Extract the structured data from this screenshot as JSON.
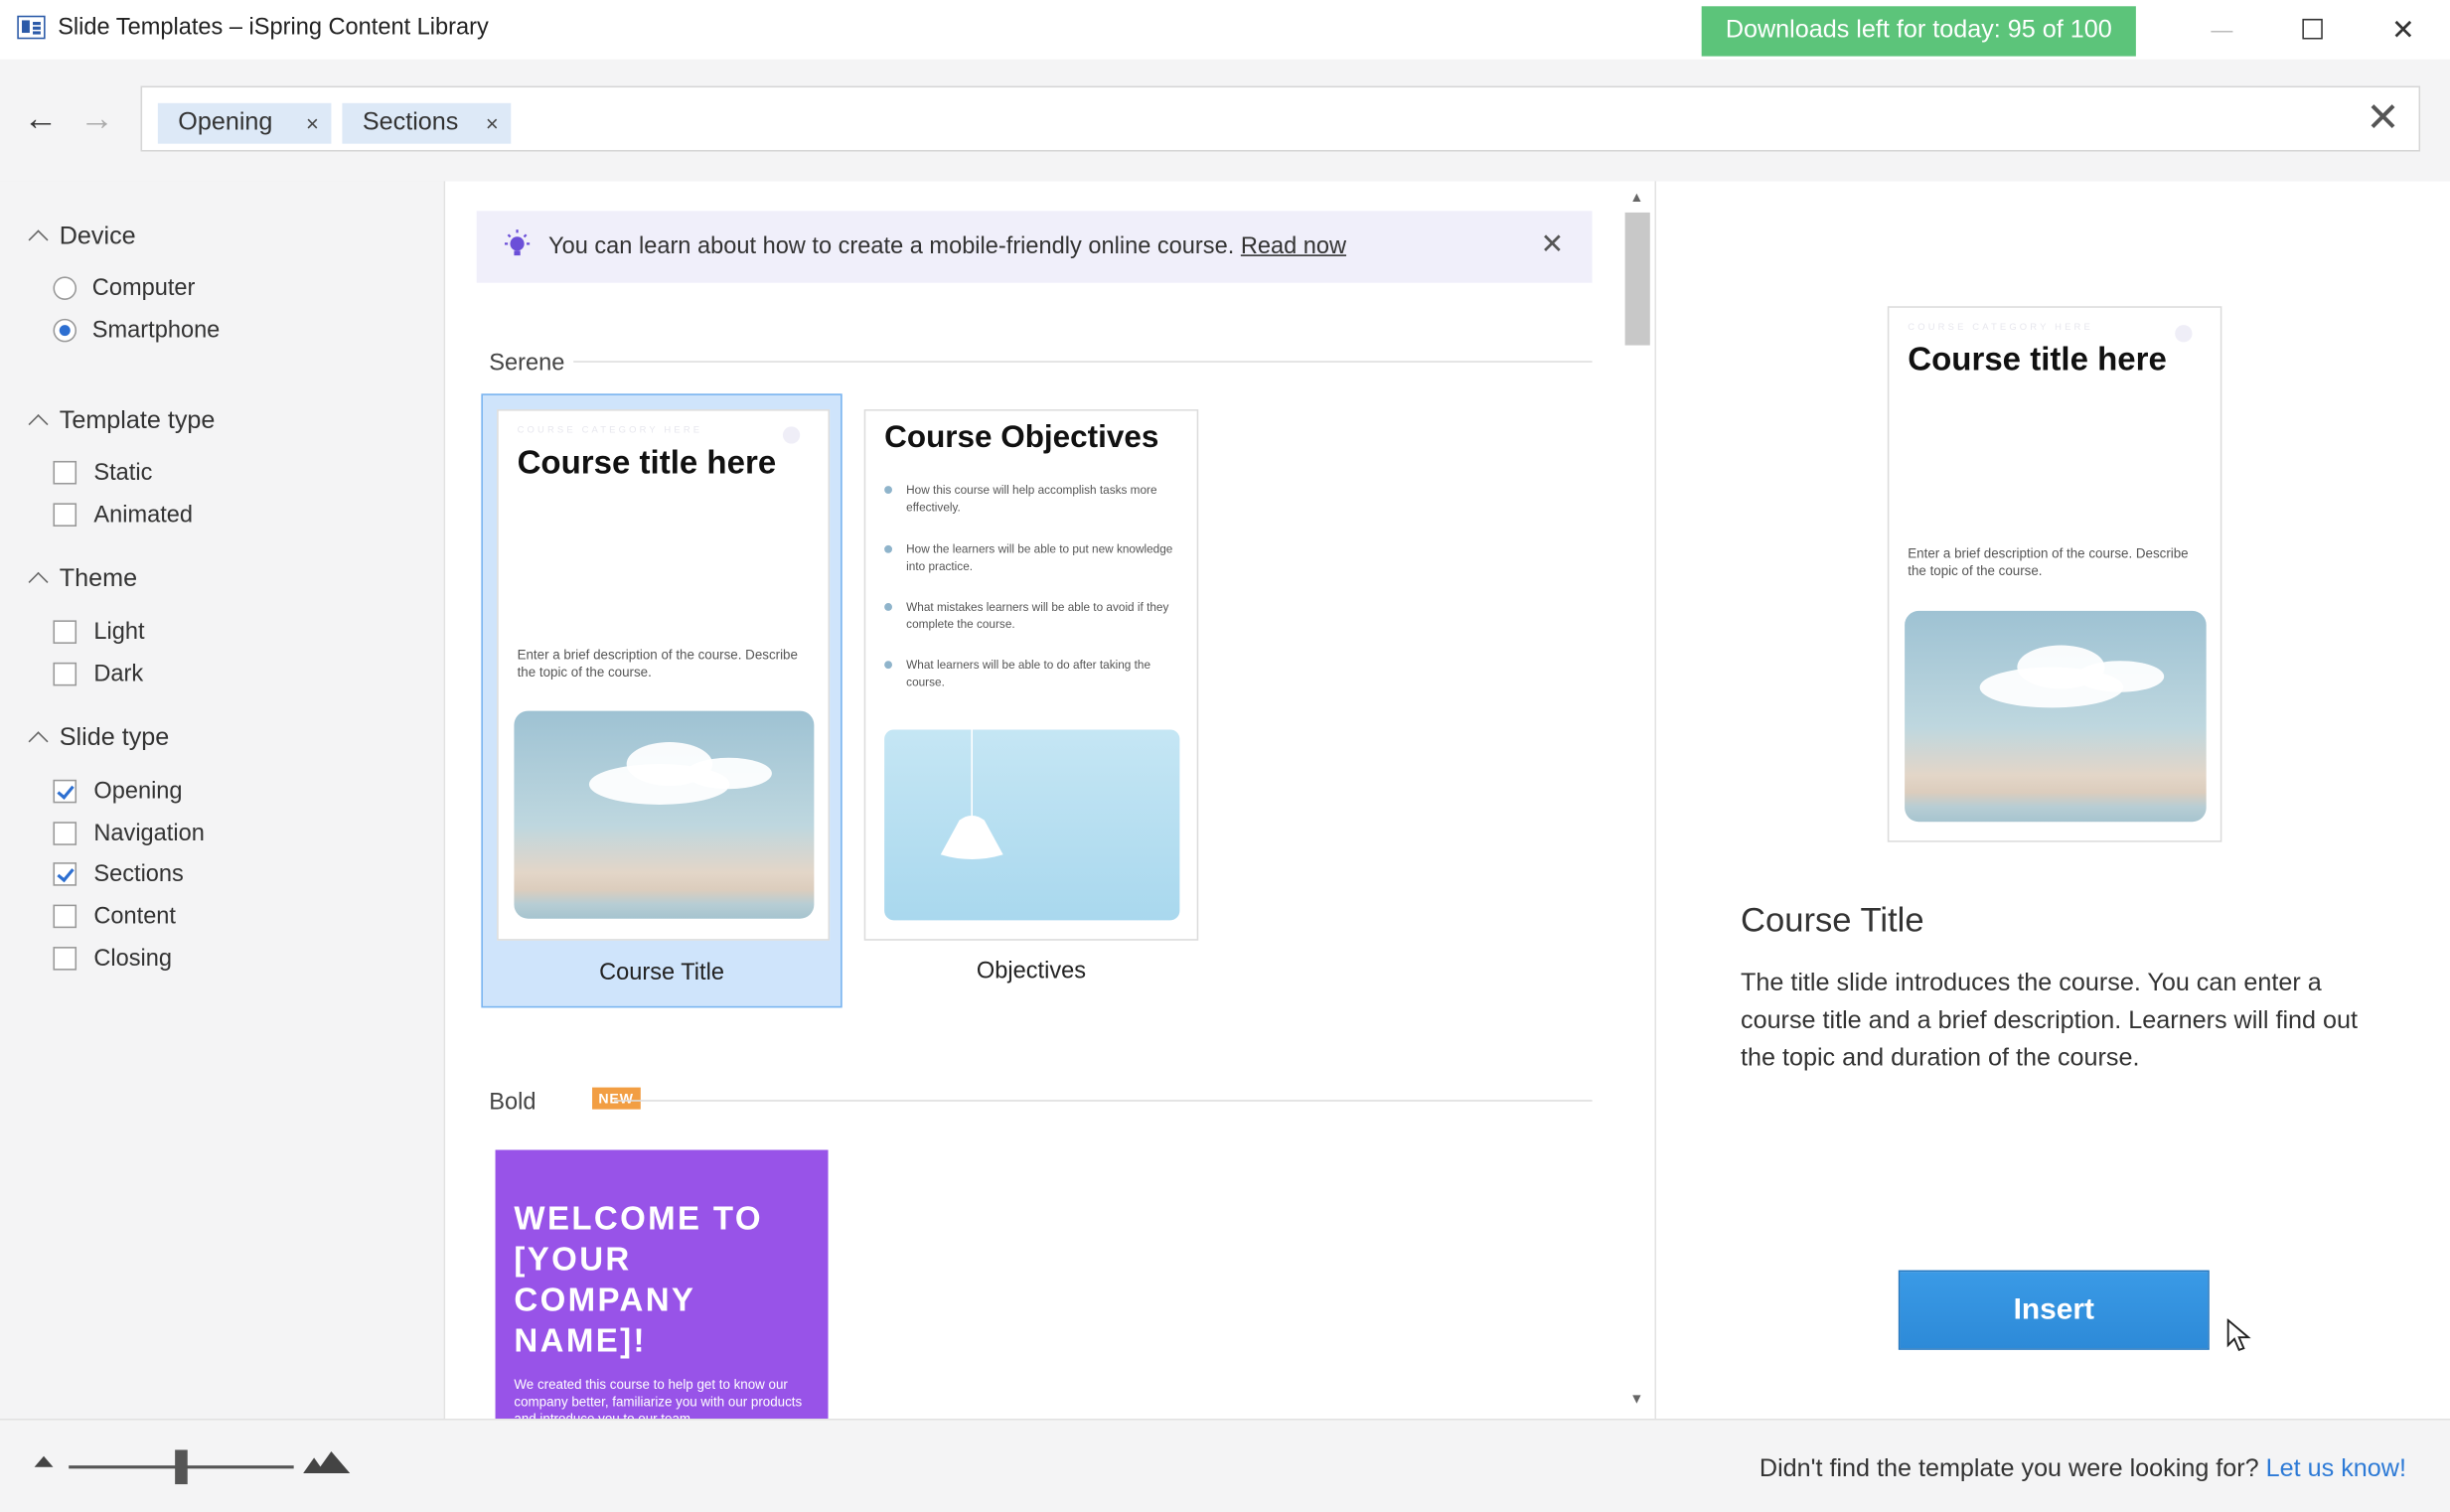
{
  "window": {
    "title": "Slide Templates – iSpring Content Library",
    "downloads_badge": "Downloads left for today: 95 of 100",
    "controls": {
      "minimize": "—",
      "maximize": "☐",
      "close": "✕"
    }
  },
  "nav": {
    "back": "←",
    "forward": "→"
  },
  "search": {
    "chips": [
      {
        "label": "Opening",
        "remove": "×"
      },
      {
        "label": "Sections",
        "remove": "×"
      }
    ],
    "clear": "✕"
  },
  "filters": {
    "device": {
      "title": "Device",
      "options": [
        {
          "label": "Computer",
          "selected": false
        },
        {
          "label": "Smartphone",
          "selected": true
        }
      ]
    },
    "template_type": {
      "title": "Template type",
      "options": [
        {
          "label": "Static",
          "checked": false
        },
        {
          "label": "Animated",
          "checked": false
        }
      ]
    },
    "theme": {
      "title": "Theme",
      "options": [
        {
          "label": "Light",
          "checked": false
        },
        {
          "label": "Dark",
          "checked": false
        }
      ]
    },
    "slide_type": {
      "title": "Slide type",
      "options": [
        {
          "label": "Opening",
          "checked": true
        },
        {
          "label": "Navigation",
          "checked": false
        },
        {
          "label": "Sections",
          "checked": true
        },
        {
          "label": "Content",
          "checked": false
        },
        {
          "label": "Closing",
          "checked": false
        }
      ]
    }
  },
  "banner": {
    "text": "You can learn about how to create a mobile-friendly online course.",
    "link": "Read now",
    "close": "✕"
  },
  "groups": {
    "serene": {
      "label": "Serene",
      "templates": {
        "course_title": {
          "name": "Course Title",
          "category": "COURSE CATEGORY HERE",
          "title": "Course title here",
          "description": "Enter a brief description of the course. Describe the topic of the course."
        },
        "objectives": {
          "name": "Objectives",
          "title": "Course Objectives",
          "bullets": [
            "How this course will help accomplish tasks more effectively.",
            "How the learners will be able to put new knowledge into practice.",
            "What mistakes learners will be able to avoid if they complete the course.",
            "What learners will be able to do after taking the course."
          ]
        }
      }
    },
    "bold": {
      "label": "Bold",
      "badge": "NEW",
      "templates": {
        "welcome": {
          "title": "WELCOME TO [YOUR COMPANY NAME]!",
          "text": "We created this course to help get to know our company better, familiarize you with our products and introduce you to our team."
        }
      }
    }
  },
  "preview": {
    "category": "COURSE CATEGORY HERE",
    "thumb_title": "Course title here",
    "thumb_desc": "Enter a brief description of the course. Describe the topic of the course.",
    "title": "Course Title",
    "description": "The title slide introduces the course. You can enter a course title and a brief description. Learners will find out the topic and duration of the course.",
    "insert": "Insert"
  },
  "footer": {
    "text": "Didn't find the template you were looking for?",
    "link": "Let us know!"
  },
  "colors": {
    "downloads_badge": "#5cc47a",
    "chip_bg": "#dde9f7",
    "selected_card": "#cfe4fb",
    "insert_button": "#2d8ad8",
    "bold_template": "#9853e8",
    "link": "#2d7ad6",
    "new_badge": "#f29e43"
  }
}
